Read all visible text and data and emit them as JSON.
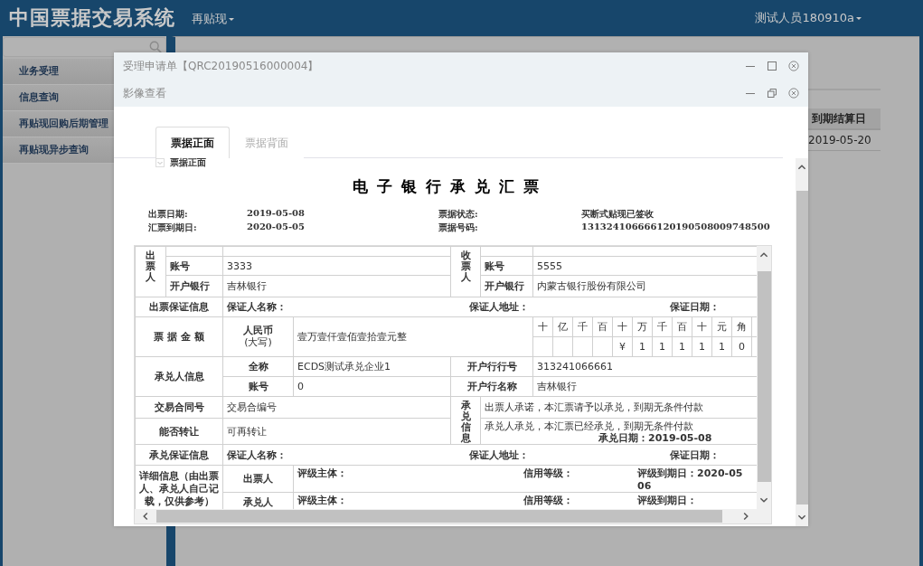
{
  "header": {
    "title": "中国票据交易系统",
    "menu": "再贴现",
    "user": "测试人员180910a"
  },
  "sidebar": {
    "items": [
      {
        "label": "业务受理"
      },
      {
        "label": "信息查询"
      },
      {
        "label": "再贴现回购后期管理"
      },
      {
        "label": "再贴现异步查询"
      }
    ]
  },
  "background_table": {
    "column": "到期结算日",
    "cell": "2019-05-20"
  },
  "dialog": {
    "title": "受理申请单【QRC20190516000004】"
  },
  "viewer": {
    "title": "影像查看",
    "tabs": [
      {
        "label": "票据正面",
        "selected": true
      },
      {
        "label": "票据背面",
        "selected": false
      }
    ],
    "caption": "票据正面"
  },
  "bill": {
    "title": "电 子 银 行 承 兑 汇 票",
    "info": [
      {
        "label": "出票日期:",
        "value": "2019-05-08"
      },
      {
        "label": "票据状态:",
        "value": "买断式贴现已签收"
      },
      {
        "label": "汇票到期日:",
        "value": "2020-05-05"
      },
      {
        "label": "票据号码:",
        "value": "131324106666120190508009748500"
      }
    ],
    "drawer": {
      "heading": "出票人",
      "account_label": "账号",
      "account": "3333",
      "bank_label": "开户银行",
      "bank": "吉林银行"
    },
    "payee": {
      "heading": "收票人",
      "account_label": "账号",
      "account": "5555",
      "bank_label": "开户银行",
      "bank": "内蒙古银行股份有限公司"
    },
    "drawer_guarantee": {
      "heading": "出票保证信息",
      "fields": [
        "保证人名称：",
        "保证人地址：",
        "保证日期："
      ]
    },
    "amount": {
      "heading": "票 据 金 额",
      "currency": "人民币",
      "currency_note": "(大写)",
      "words": "壹万壹仟壹佰壹拾壹元整",
      "places": [
        {
          "unit": "十"
        },
        {
          "unit": "亿"
        },
        {
          "unit": "千"
        },
        {
          "unit": "百"
        },
        {
          "unit": "十",
          "digit": "¥"
        },
        {
          "unit": "万",
          "digit": "1"
        },
        {
          "unit": "千",
          "digit": "1"
        },
        {
          "unit": "百",
          "digit": "1"
        },
        {
          "unit": "十",
          "digit": "1"
        },
        {
          "unit": "元",
          "digit": "1"
        },
        {
          "unit": "角",
          "digit": "0"
        }
      ]
    },
    "acceptor": {
      "heading": "承兑人信息",
      "name_label": "全称",
      "name": "ECDS测试承兑企业1",
      "account_label": "账号",
      "account": "0",
      "bank_no_label": "开户行行号",
      "bank_no": "313241066661",
      "bank_name_label": "开户行名称",
      "bank_name": "吉林银行"
    },
    "contract": {
      "label": "交易合同号",
      "value": "交易合编号"
    },
    "transfer": {
      "label": "能否转让",
      "value": "可再转让"
    },
    "acceptance": {
      "heading": "承兑信息",
      "drawer_promise": "出票人承诺，本汇票请予以承兑，到期无条件付款",
      "acceptor_promise": "承兑人承兑，本汇票已经承兑，到期无条件付款",
      "date": "承兑日期：2019-05-08"
    },
    "acceptor_guarantee": {
      "heading": "承兑保证信息",
      "fields": [
        "保证人名称：",
        "保证人地址：",
        "保证日期："
      ]
    },
    "details": {
      "heading": "详细信息（由出票人、承兑人自己记载，仅供参考）",
      "rows": [
        {
          "party": "出票人",
          "fields": [
            [
              "评级主体："
            ],
            [
              "信用等级："
            ],
            [
              "评级到期日：2020-05",
              "06"
            ]
          ]
        },
        {
          "party": "承兑人",
          "fields": [
            [
              "评级主体："
            ],
            [
              "信用等级："
            ],
            [
              "评级到期日："
            ]
          ]
        }
      ]
    }
  }
}
